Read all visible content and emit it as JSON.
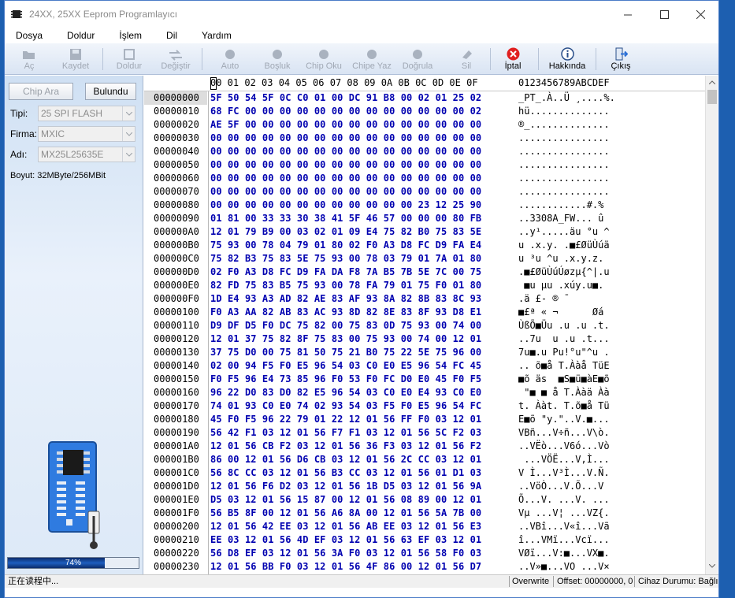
{
  "window": {
    "title": "24XX, 25XX Eeprom Programlayıcı"
  },
  "menu": [
    "Dosya",
    "Doldur",
    "İşlem",
    "Dil",
    "Yardım"
  ],
  "toolbar": {
    "buttons": [
      {
        "label": "Aç",
        "icon": "folder-open-icon",
        "enabled": false
      },
      {
        "label": "Kaydet",
        "icon": "save-icon",
        "enabled": false
      },
      {
        "label": "Doldur",
        "icon": "fill-icon",
        "enabled": false
      },
      {
        "label": "Değiştir",
        "icon": "swap-icon",
        "enabled": false
      },
      {
        "label": "Auto",
        "icon": "auto-icon",
        "enabled": false
      },
      {
        "label": "Boşluk",
        "icon": "blank-check-icon",
        "enabled": false
      },
      {
        "label": "Chip Oku",
        "icon": "chip-read-icon",
        "enabled": false
      },
      {
        "label": "Chipe Yaz",
        "icon": "chip-write-icon",
        "enabled": false
      },
      {
        "label": "Doğrula",
        "icon": "verify-icon",
        "enabled": false
      },
      {
        "label": "Sil",
        "icon": "erase-icon",
        "enabled": false
      },
      {
        "label": "İptal",
        "icon": "cancel-icon",
        "enabled": true
      },
      {
        "label": "Hakkında",
        "icon": "info-icon",
        "enabled": true
      },
      {
        "label": "Çıkış",
        "icon": "exit-icon",
        "enabled": true
      }
    ]
  },
  "left_panel": {
    "chip_ara": "Chip Ara",
    "bulundu": "Bulundu",
    "tipi_label": "Tipi:",
    "tipi_value": "25 SPI FLASH",
    "firma_label": "Firma:",
    "firma_value": "MXIC",
    "adi_label": "Adı:",
    "adi_value": "MX25L25635E",
    "boyut": "Boyut: 32MByte/256MBit",
    "progress": 74,
    "progress_text": "74%"
  },
  "hex": {
    "header_cells": "00 01 02 03 04 05 06 07 08 09 0A 0B 0C 0D 0E 0F",
    "header_ascii": "0123456789ABCDEF",
    "rows": [
      {
        "addr": "00000000",
        "hex": "5F 50 54 5F 0C C0 01 00 DC 91 B8 00 02 01 25 02",
        "ascii": "_PT_.À..Ü ¸....%."
      },
      {
        "addr": "00000010",
        "hex": "68 FC 00 00 00 00 00 00 00 00 00 00 00 00 00 02",
        "ascii": "hü.............."
      },
      {
        "addr": "00000020",
        "hex": "AE 5F 00 00 00 00 00 00 00 00 00 00 00 00 00 00",
        "ascii": "®_.............."
      },
      {
        "addr": "00000030",
        "hex": "00 00 00 00 00 00 00 00 00 00 00 00 00 00 00 00",
        "ascii": "................"
      },
      {
        "addr": "00000040",
        "hex": "00 00 00 00 00 00 00 00 00 00 00 00 00 00 00 00",
        "ascii": "................"
      },
      {
        "addr": "00000050",
        "hex": "00 00 00 00 00 00 00 00 00 00 00 00 00 00 00 00",
        "ascii": "................"
      },
      {
        "addr": "00000060",
        "hex": "00 00 00 00 00 00 00 00 00 00 00 00 00 00 00 00",
        "ascii": "................"
      },
      {
        "addr": "00000070",
        "hex": "00 00 00 00 00 00 00 00 00 00 00 00 00 00 00 00",
        "ascii": "................"
      },
      {
        "addr": "00000080",
        "hex": "00 00 00 00 00 00 00 00 00 00 00 00 23 12 25 90",
        "ascii": "............#.%"
      },
      {
        "addr": "00000090",
        "hex": "01 81 00 33 33 30 38 41 5F 46 57 00 00 00 80 FB",
        "ascii": "..3308A_FW... û"
      },
      {
        "addr": "000000A0",
        "hex": "12 01 79 B9 00 03 02 01 09 E4 75 82 B0 75 83 5E",
        "ascii": "..y¹.....äu °u ^"
      },
      {
        "addr": "000000B0",
        "hex": "75 93 00 78 04 79 01 80 02 F0 A3 D8 FC D9 FA E4",
        "ascii": "u .x.y. .■£ØüÙúä"
      },
      {
        "addr": "000000C0",
        "hex": "75 82 B3 75 83 5E 75 93 00 78 03 79 01 7A 01 80",
        "ascii": "u ³u ^u .x.y.z."
      },
      {
        "addr": "000000D0",
        "hex": "02 F0 A3 D8 FC D9 FA DA F8 7A B5 7B 5E 7C 00 75",
        "ascii": ".■£ØüÙúÚøzµ{^|.u"
      },
      {
        "addr": "000000E0",
        "hex": "82 FD 75 83 B5 75 93 00 78 FA 79 01 75 F0 01 80",
        "ascii": " ■u µu .xúy.u■."
      },
      {
        "addr": "000000F0",
        "hex": "1D E4 93 A3 AD 82 AE 83 AF 93 8A 82 8B 83 8C 93",
        "ascii": ".ä £- ® ¯"
      },
      {
        "addr": "00000100",
        "hex": "F0 A3 AA 82 AB 83 AC 93 8D 82 8E 83 8F 93 D8 E1",
        "ascii": "■£ª « ¬      Øá"
      },
      {
        "addr": "00000110",
        "hex": "D9 DF D5 F0 DC 75 82 00 75 83 0D 75 93 00 74 00",
        "ascii": "ÙßÕ■Üu .u .u .t."
      },
      {
        "addr": "00000120",
        "hex": "12 01 37 75 82 8F 75 83 00 75 93 00 74 00 12 01",
        "ascii": "..7u  u .u .t..."
      },
      {
        "addr": "00000130",
        "hex": "37 75 D0 00 75 81 50 75 21 B0 75 22 5E 75 96 00",
        "ascii": "7u■.u Pu!°u\"^u ."
      },
      {
        "addr": "00000140",
        "hex": "02 00 94 F5 F0 E5 96 54 03 C0 E0 E5 96 54 FC 45",
        "ascii": ".. õ■å T.Ààå TüE"
      },
      {
        "addr": "00000150",
        "hex": "F0 F5 96 E4 73 85 96 F0 53 F0 FC D0 E0 45 F0 F5",
        "ascii": "■õ äs  ■S■ü■àE■õ"
      },
      {
        "addr": "00000160",
        "hex": "96 22 D0 83 D0 82 E5 96 54 03 C0 E0 E4 93 C0 E0",
        "ascii": " \"■ ■ å T.Ààä Àà"
      },
      {
        "addr": "00000170",
        "hex": "74 01 93 C0 E0 74 02 93 54 03 F5 F0 E5 96 54 FC",
        "ascii": "t. Ààt. T.õ■å Tü"
      },
      {
        "addr": "00000180",
        "hex": "45 F0 F5 96 22 79 01 22 12 01 56 FF F0 03 12 01",
        "ascii": "E■õ \"y.\"..V.■..."
      },
      {
        "addr": "00000190",
        "hex": "56 42 F1 03 12 01 56 F7 F1 03 12 01 56 5C F2 03",
        "ascii": "VBñ...V÷ñ...V\\ò."
      },
      {
        "addr": "000001A0",
        "hex": "12 01 56 CB F2 03 12 01 56 36 F3 03 12 01 56 F2",
        "ascii": "..VËò...V6ó...Vò"
      },
      {
        "addr": "000001B0",
        "hex": "86 00 12 01 56 D6 CB 03 12 01 56 2C CC 03 12 01",
        "ascii": " ...VÖË...V,Ì..."
      },
      {
        "addr": "000001C0",
        "hex": "56 8C CC 03 12 01 56 B3 CC 03 12 01 56 01 D1 03",
        "ascii": "V Ì...V³Ì...V.Ñ."
      },
      {
        "addr": "000001D0",
        "hex": "12 01 56 F6 D2 03 12 01 56 1B D5 03 12 01 56 9A",
        "ascii": "..VöÒ...V.Õ...V"
      },
      {
        "addr": "000001E0",
        "hex": "D5 03 12 01 56 15 87 00 12 01 56 08 89 00 12 01",
        "ascii": "Õ...V. ...V. ..."
      },
      {
        "addr": "000001F0",
        "hex": "56 B5 8F 00 12 01 56 A6 8A 00 12 01 56 5A 7B 00",
        "ascii": "Vµ ...V¦ ...VZ{."
      },
      {
        "addr": "00000200",
        "hex": "12 01 56 42 EE 03 12 01 56 AB EE 03 12 01 56 E3",
        "ascii": "..VBî...V«î...Vã"
      },
      {
        "addr": "00000210",
        "hex": "EE 03 12 01 56 4D EF 03 12 01 56 63 EF 03 12 01",
        "ascii": "î...VMï...Vcï..."
      },
      {
        "addr": "00000220",
        "hex": "56 D8 EF 03 12 01 56 3A F0 03 12 01 56 58 F0 03",
        "ascii": "VØï...V:■...VX■."
      },
      {
        "addr": "00000230",
        "hex": "12 01 56 BB F0 03 12 01 56 4F 86 00 12 01 56 D7",
        "ascii": "..V»■...VO ...V×"
      }
    ]
  },
  "status": {
    "left": "正在读程中...",
    "mode": "Overwrite",
    "offset": "Offset: 00000000, 0",
    "device": "Cihaz Durumu: Bağlı"
  },
  "colors": {
    "hex_text": "#0000b0",
    "accent": "#1e5fbf",
    "cancel": "#e02020"
  }
}
